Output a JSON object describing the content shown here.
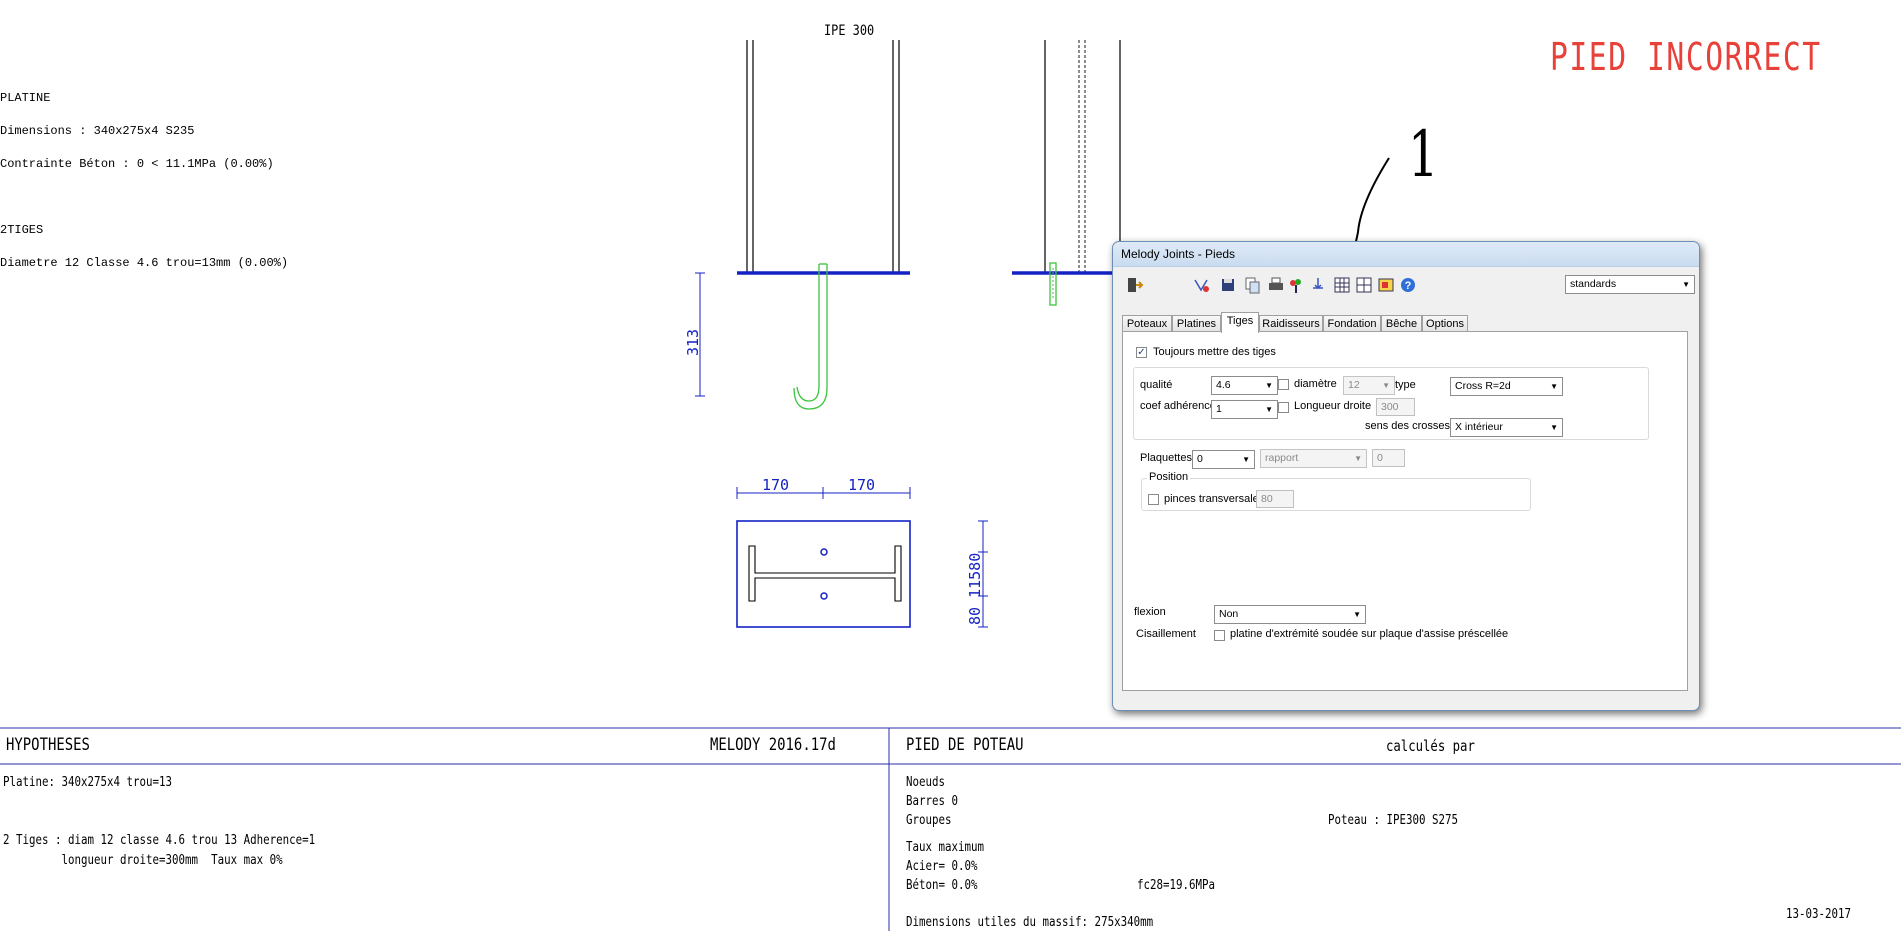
{
  "report": {
    "platine_title": "PLATINE",
    "platine_dimensions": "Dimensions : 340x275x4 S235",
    "platine_contrainte": "Contrainte Béton : 0 < 11.1MPa (0.00%)",
    "tiges_title": "2TIGES",
    "tiges_diametre": "Diametre 12 Classe 4.6 trou=13mm (0.00%)"
  },
  "drawing": {
    "profile_label": "IPE 300",
    "status": "PIED INCORRECT",
    "status_color": "#e8413a",
    "dim_height": "313",
    "dim_left": "170",
    "dim_right": "170",
    "dim_vertical": "80 11580",
    "annotation": "1"
  },
  "dialog": {
    "title": "Melody Joints - Pieds",
    "preset_select": "standards",
    "tabs": [
      "Poteaux",
      "Platines",
      "Tiges",
      "Raidisseurs",
      "Fondation",
      "Bêche",
      "Options"
    ],
    "active_tab": "Tiges",
    "always_rods_label": "Toujours mettre des tiges",
    "always_rods_checked": true,
    "qualite_label": "qualité",
    "qualite_value": "4.6",
    "diametre_label": "diamètre",
    "diametre_value": "12",
    "type_label": "type",
    "type_value": "Cross R=2d",
    "coef_label": "coef adhérence",
    "coef_value": "1",
    "longueur_label": "Longueur droite",
    "longueur_value": "300",
    "sens_label": "sens des crosses",
    "sens_value": "X intérieur",
    "plaquettes_label": "Plaquettes",
    "plaquettes_value": "0",
    "rapport_value": "rapport",
    "rapport_number": "0",
    "position_label": "Position",
    "pinces_label": "pinces transversales",
    "pinces_value": "80",
    "flexion_label": "flexion",
    "flexion_value": "Non",
    "cisaillement_label": "Cisaillement",
    "cisaillement_option": "platine d'extrémité soudée sur plaque d'assise préscellée",
    "toolbar_icons": [
      "exit-icon",
      "calc-icon",
      "save-icon",
      "copy-icon",
      "print-icon",
      "color-icon",
      "rods-icon",
      "grid-icon",
      "layout-icon",
      "image-icon",
      "help-icon"
    ]
  },
  "table": {
    "hypotheses_title": "HYPOTHESES",
    "version": "MELODY 2016.17d",
    "pied_title": "PIED DE POTEAU",
    "calcules_par": "calculés par",
    "platine_line": "Platine: 340x275x4 trou=13",
    "tiges_line1": "2 Tiges : diam 12 classe 4.6 trou 13 Adherence=1",
    "tiges_line2": "         longueur droite=300mm  Taux max 0%",
    "noeuds": "Noeuds",
    "barres": "Barres 0",
    "groupes": "Groupes",
    "poteau": "Poteau : IPE300 S275",
    "taux_max": "Taux maximum",
    "acier": "Acier= 0.0%",
    "beton": "Béton= 0.0%",
    "fc28": "fc28=19.6MPa",
    "dimensions_massif": "Dimensions utiles du massif: 275x340mm",
    "date": "13-03-2017"
  }
}
